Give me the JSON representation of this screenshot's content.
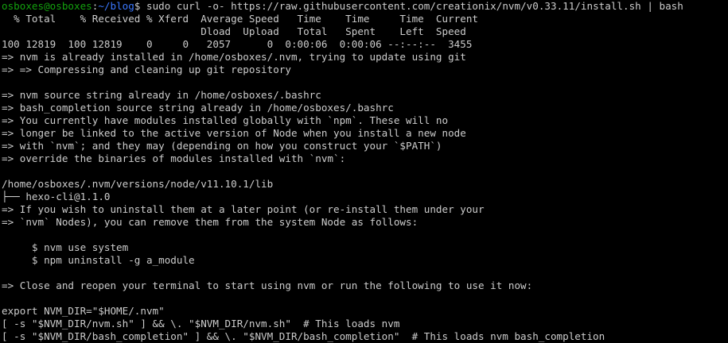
{
  "prompt": {
    "user_host": "osboxes@osboxes",
    "separator": ":",
    "path": "~/blog",
    "dollar": "$",
    "command": " sudo curl -o- https://raw.githubusercontent.com/creationix/nvm/v0.33.11/install.sh | bash"
  },
  "output_lines": [
    "  % Total    % Received % Xferd  Average Speed   Time    Time     Time  Current",
    "                                 Dload  Upload   Total   Spent    Left  Speed",
    "100 12819  100 12819    0     0   2057      0  0:00:06  0:00:06 --:--:--  3455",
    "=> nvm is already installed in /home/osboxes/.nvm, trying to update using git",
    "=> => Compressing and cleaning up git repository",
    "",
    "=> nvm source string already in /home/osboxes/.bashrc",
    "=> bash_completion source string already in /home/osboxes/.bashrc",
    "=> You currently have modules installed globally with `npm`. These will no",
    "=> longer be linked to the active version of Node when you install a new node",
    "=> with `nvm`; and they may (depending on how you construct your `$PATH`)",
    "=> override the binaries of modules installed with `nvm`:",
    "",
    "/home/osboxes/.nvm/versions/node/v11.10.1/lib",
    "├── hexo-cli@1.1.0",
    "=> If you wish to uninstall them at a later point (or re-install them under your",
    "=> `nvm` Nodes), you can remove them from the system Node as follows:",
    "",
    "     $ nvm use system",
    "     $ npm uninstall -g a_module",
    "",
    "=> Close and reopen your terminal to start using nvm or run the following to use it now:",
    "",
    "export NVM_DIR=\"$HOME/.nvm\"",
    "[ -s \"$NVM_DIR/nvm.sh\" ] && \\. \"$NVM_DIR/nvm.sh\"  # This loads nvm",
    "[ -s \"$NVM_DIR/bash_completion\" ] && \\. \"$NVM_DIR/bash_completion\"  # This loads nvm bash_completion"
  ],
  "colors": {
    "background": "#000000",
    "foreground": "#cccccc",
    "prompt_user": "#13a10e",
    "prompt_path": "#3b78ff"
  }
}
